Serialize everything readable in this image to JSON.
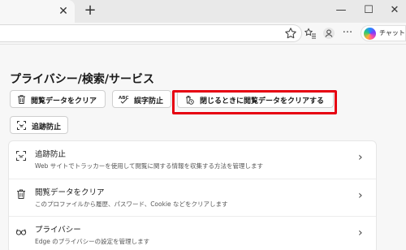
{
  "window": {
    "tab_close_glyph": "✕",
    "new_tab_glyph": "+",
    "minimize_glyph": "—",
    "maximize_glyph": "☐",
    "close_glyph": "✕"
  },
  "toolbar": {
    "more_glyph": "···",
    "copilot_label": "チャット",
    "icons": [
      "star-icon",
      "favorites-icon",
      "profile-icon",
      "more-icon",
      "copilot-icon"
    ]
  },
  "page": {
    "title": "プライバシー/検索/サービス"
  },
  "quick_actions": [
    {
      "label": "閲覧データをクリア",
      "icon": "trash-icon"
    },
    {
      "label": "誤字防止",
      "icon": "spellcheck-icon"
    },
    {
      "label": "閉じるときに閲覧データをクリアする",
      "icon": "clock-lock-icon"
    },
    {
      "label": "追跡防止",
      "icon": "tracking-prevention-icon"
    }
  ],
  "settings": [
    {
      "title": "追跡防止",
      "description": "Web サイトでトラッカーを使用して閲覧に関する情報を収集する方法を管理します",
      "icon": "tracking-prevention-icon"
    },
    {
      "title": "閲覧データをクリア",
      "description": "このプロファイルから履歴、パスワード、Cookie などをクリアします",
      "icon": "trash-icon"
    },
    {
      "title": "プライバシー",
      "description": "Edge のプライバシーの設定を管理します",
      "icon": "glasses-icon"
    }
  ],
  "chevron_glyph": "›",
  "colors": {
    "highlight": "#e60012"
  }
}
